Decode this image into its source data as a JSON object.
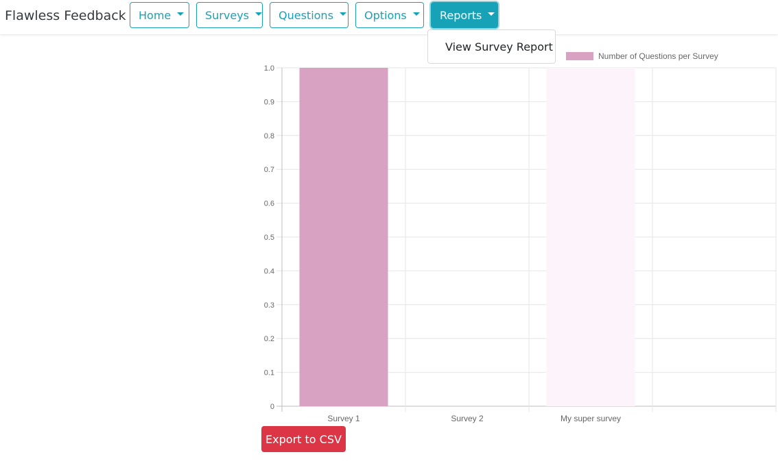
{
  "app": {
    "brand": "Flawless Feedback"
  },
  "nav": {
    "items": [
      {
        "label": "Home",
        "active": false
      },
      {
        "label": "Surveys",
        "active": false
      },
      {
        "label": "Questions",
        "active": false
      },
      {
        "label": "Options",
        "active": false
      },
      {
        "label": "Reports",
        "active": true
      }
    ],
    "reports_menu": {
      "items": [
        {
          "label": "View Survey Report"
        }
      ]
    }
  },
  "actions": {
    "export_label": "Export to CSV"
  },
  "colors": {
    "accent": "#17a2b8",
    "danger": "#dc3545",
    "bar": "#d8a2c2"
  },
  "chart_data": {
    "type": "bar",
    "categories": [
      "Survey 1",
      "Survey 2",
      "My super survey",
      ""
    ],
    "series": [
      {
        "name": "Number of Questions per Survey",
        "values": [
          1,
          0,
          0,
          0
        ],
        "colors": [
          "#d8a2c2",
          "#d8a2c2",
          "#fcf4fa",
          "#d8a2c2"
        ]
      }
    ],
    "yticks": [
      "1.0",
      "0.9",
      "0.8",
      "0.7",
      "0.6",
      "0.5",
      "0.4",
      "0.3",
      "0.2",
      "0.1",
      "0"
    ],
    "ylim": [
      0,
      1
    ],
    "grid": true,
    "legend": "top"
  }
}
